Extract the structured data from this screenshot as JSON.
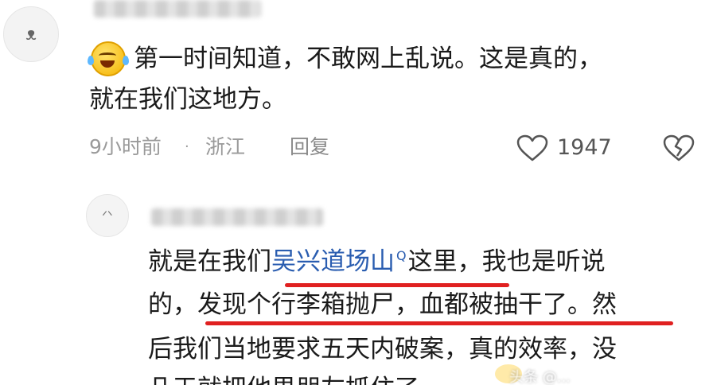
{
  "comment": {
    "line1": "第一时间知道，不敢网上乱说。这是真的，",
    "line2": "就在我们这地方。",
    "time": "9小时前",
    "separator": "·",
    "location": "浙江",
    "reply_label": "回复",
    "like_count": "1947",
    "emoji_icon": "laugh-cry-emoji",
    "like_icon": "heart-outline-icon",
    "dislike_icon": "broken-heart-icon"
  },
  "reply": {
    "prefix": "就是在我们",
    "link_text": "吴兴道场山",
    "search_glyph": "Q",
    "suffix": "这里，我也是听说",
    "line2": "的，发现个行李箱抛尸，血都被抽干了。然",
    "line3": "后我们当地要求五天内破案，真的效率，没",
    "line4": "几天就把他男朋友抓住了",
    "link_color": "#2a5db0",
    "underline_color": "#e02020"
  },
  "watermark": "头条 @..."
}
